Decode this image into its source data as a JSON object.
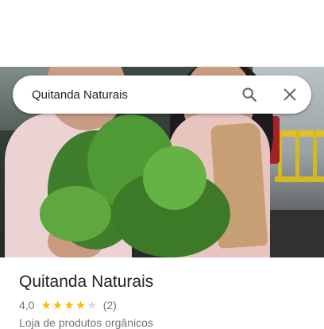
{
  "search": {
    "query": "Quitanda Naturais"
  },
  "icons": {
    "search": "search-icon",
    "close": "close-icon",
    "star": "star-icon"
  },
  "place": {
    "name": "Quitanda Naturais",
    "rating": "4,0",
    "stars_filled": 4,
    "stars_total": 5,
    "review_count": "(2)",
    "category": "Loja de produtos orgânicos"
  },
  "colors": {
    "star_filled": "#fbbc04",
    "star_empty": "#dadce0",
    "text_primary": "#202124",
    "text_secondary": "#70757a"
  }
}
